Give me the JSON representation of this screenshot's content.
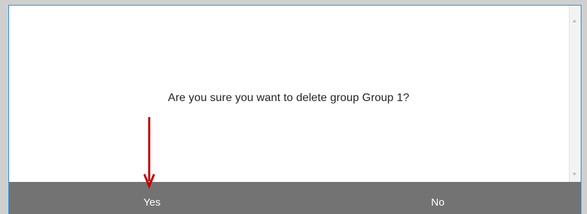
{
  "dialog": {
    "message": "Are you sure you want to delete group Group 1?",
    "buttons": {
      "yes_label": "Yes",
      "no_label": "No"
    }
  },
  "colors": {
    "button_bar": "#737373",
    "dialog_border": "#2e8bd3",
    "annotation_arrow": "#c00000"
  },
  "icons": {
    "annotation": "red-down-arrow-icon",
    "scroll_up": "scroll-up-arrow-icon",
    "scroll_down": "scroll-down-arrow-icon"
  }
}
